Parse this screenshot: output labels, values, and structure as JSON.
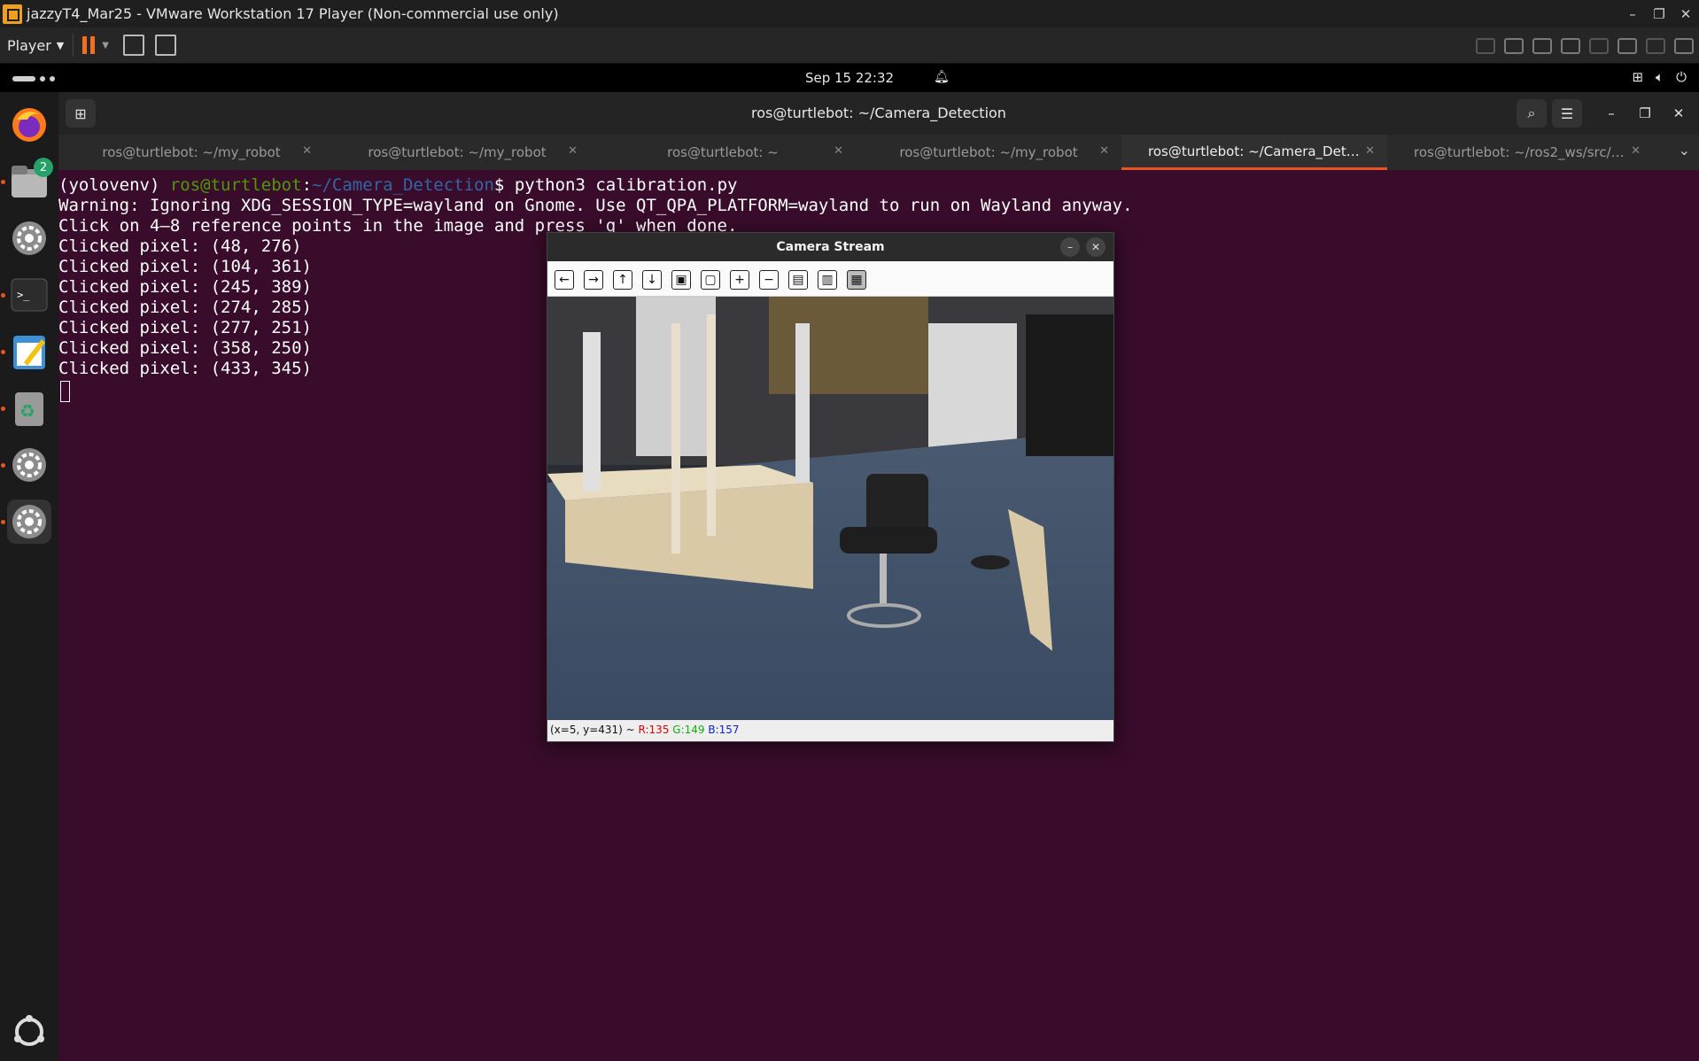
{
  "vmware": {
    "window_title": "jazzyT4_Mar25 - VMware Workstation 17 Player (Non-commercial use only)",
    "player_menu": "Player"
  },
  "panel": {
    "clock": "Sep 15  22:32"
  },
  "dock": {
    "files_badge": "2"
  },
  "terminal": {
    "title": "ros@turtlebot: ~/Camera_Detection",
    "tabs": [
      {
        "label": "ros@turtlebot: ~/my_robot",
        "active": false
      },
      {
        "label": "ros@turtlebot: ~/my_robot",
        "active": false
      },
      {
        "label": "ros@turtlebot: ~",
        "active": false
      },
      {
        "label": "ros@turtlebot: ~/my_robot",
        "active": false
      },
      {
        "label": "ros@turtlebot: ~/Camera_Detecti...",
        "active": true
      },
      {
        "label": "ros@turtlebot: ~/ros2_ws/src/obs...",
        "active": false
      }
    ],
    "prompt": {
      "venv": "(yolovenv) ",
      "user_host": "ros@turtlebot",
      "colon": ":",
      "path": "~/Camera_Detection",
      "dollar": "$ ",
      "command": "python3 calibration.py"
    },
    "output": [
      "Warning: Ignoring XDG_SESSION_TYPE=wayland on Gnome. Use QT_QPA_PLATFORM=wayland to run on Wayland anyway.",
      "Click on 4–8 reference points in the image and press 'q' when done.",
      "Clicked pixel: (48, 276)",
      "Clicked pixel: (104, 361)",
      "Clicked pixel: (245, 389)",
      "Clicked pixel: (274, 285)",
      "Clicked pixel: (277, 251)",
      "Clicked pixel: (358, 250)",
      "Clicked pixel: (433, 345)"
    ]
  },
  "camera_window": {
    "title": "Camera Stream",
    "status": {
      "coords": "(x=5, y=431) ~ ",
      "r": "R:135",
      "g": "G:149",
      "b": "B:157"
    }
  },
  "colors": {
    "terminal_bg": "#380c2a",
    "accent": "#e95420",
    "prompt_user": "#4e9a06",
    "prompt_path": "#3465a4"
  }
}
